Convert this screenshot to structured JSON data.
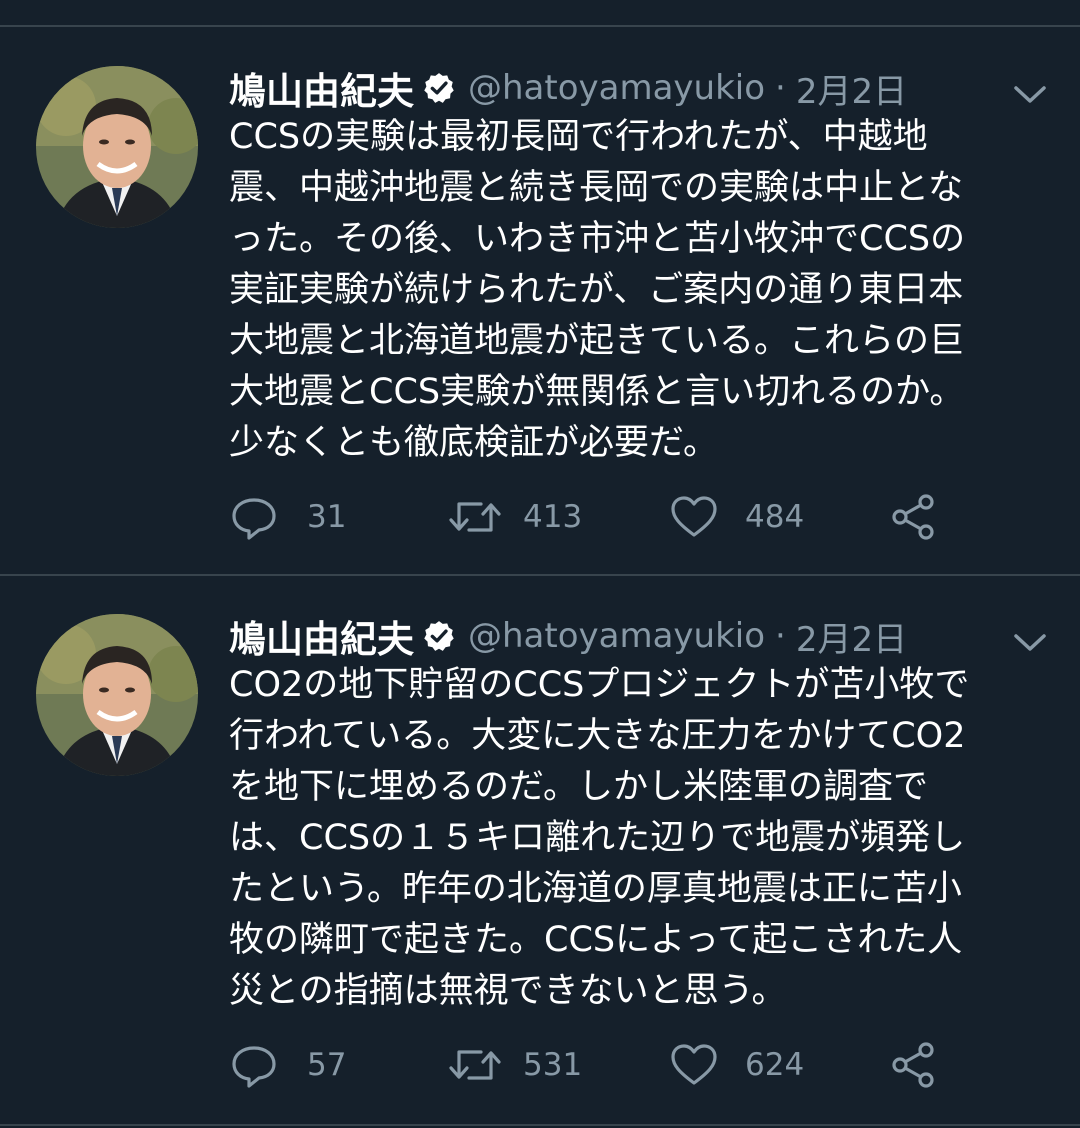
{
  "tweets": [
    {
      "author_name": "鳩山由紀夫",
      "handle": "@hatoyamayukio",
      "separator": "·",
      "date": "2月2日",
      "lines": [
        "CCSの実験は最初長岡で行われたが、中越地",
        "震、中越沖地震と続き長岡での実験は中止とな",
        "った。その後、いわき市沖と苫小牧沖でCCSの",
        "実証実験が続けられたが、ご案内の通り東日本",
        "大地震と北海道地震が起きている。これらの巨",
        "大地震とCCS実験が無関係と言い切れるのか。",
        "少なくとも徹底検証が必要だ。"
      ],
      "replies": "31",
      "retweets": "413",
      "likes": "484"
    },
    {
      "author_name": "鳩山由紀夫",
      "handle": "@hatoyamayukio",
      "separator": "·",
      "date": "2月2日",
      "lines": [
        "CO2の地下貯留のCCSプロジェクトが苫小牧で",
        "行われている。大変に大きな圧力をかけてCO2",
        "を地下に埋めるのだ。しかし米陸軍の調査で",
        "は、CCSの１５キロ離れた辺りで地震が頻発し",
        "たという。昨年の北海道の厚真地震は正に苫小",
        "牧の隣町で起きた。CCSによって起こされた人",
        "災との指摘は無視できないと思う。"
      ],
      "replies": "57",
      "retweets": "531",
      "likes": "624"
    }
  ],
  "colors": {
    "background": "#15202b",
    "divider": "#38444d",
    "text": "#ffffff",
    "secondary": "#8899a6"
  },
  "icons": [
    "verified-badge-icon",
    "chevron-down-icon",
    "reply-icon",
    "retweet-icon",
    "like-icon",
    "share-icon"
  ]
}
